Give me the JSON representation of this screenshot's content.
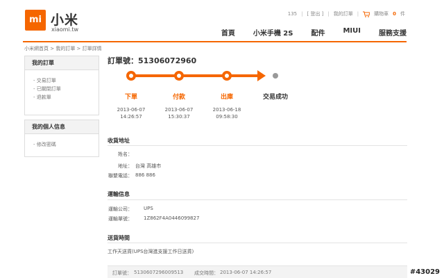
{
  "header": {
    "logo_text": "mi",
    "brand_cn": "小米",
    "brand_en": "xiaomi.tw",
    "user": "135",
    "logout": "[ 登出 ]",
    "my_orders": "我的訂單",
    "cart_label": "購物車",
    "cart_count": "0",
    "cart_unit": "件",
    "nav": [
      "首頁",
      "小米手機 2S",
      "配件",
      "MIUI",
      "服務支援"
    ]
  },
  "breadcrumb": {
    "home": "小米網首頁",
    "orders": "我的訂單",
    "current": "訂單詳情",
    "sep": " > "
  },
  "sidebar": {
    "orders_title": "我的訂單",
    "order_items": [
      "- 交易訂單",
      "- 已關閉訂單",
      "- 退款單"
    ],
    "profile_title": "我的個人信息",
    "profile_items": [
      "- 修改密碼"
    ]
  },
  "order": {
    "order_no_label": "訂單號：",
    "order_no": "51306072960",
    "steps": [
      {
        "label": "下單",
        "date": "2013-06-07",
        "time": "14:26:57",
        "done": true
      },
      {
        "label": "付款",
        "date": "2013-06-07",
        "time": "15:30:37",
        "done": true
      },
      {
        "label": "出庫",
        "date": "2013-06-18",
        "time": "09:58:30",
        "done": true
      },
      {
        "label": "交易成功",
        "date": "",
        "time": "",
        "done": false
      }
    ],
    "colors": {
      "accent": "#f56600",
      "pending": "#999999"
    }
  },
  "shipping_address": {
    "title": "收貨地址",
    "name_label": "姓名：",
    "name_value": "",
    "address_label": "地址：",
    "address_value": "台灣 高雄市",
    "phone_label": "聯繫電話：",
    "phone_value": "886 886"
  },
  "shipping_info": {
    "title": "運輸信息",
    "company_label": "運輸公司：",
    "company_value": "UPS",
    "tracking_label": "運輸單號：",
    "tracking_value": "1Z862F4A0446099827"
  },
  "delivery_time": {
    "title": "送貨時間",
    "value": "工作天送貨(UPS台灣進支援工作日送貨)"
  },
  "footer": {
    "order_label": "訂單號：",
    "order_value": "5130607296009513",
    "created_label": "成交時間：",
    "created_value": "2013-06-07 14:26:57"
  },
  "watermark": "#43029"
}
